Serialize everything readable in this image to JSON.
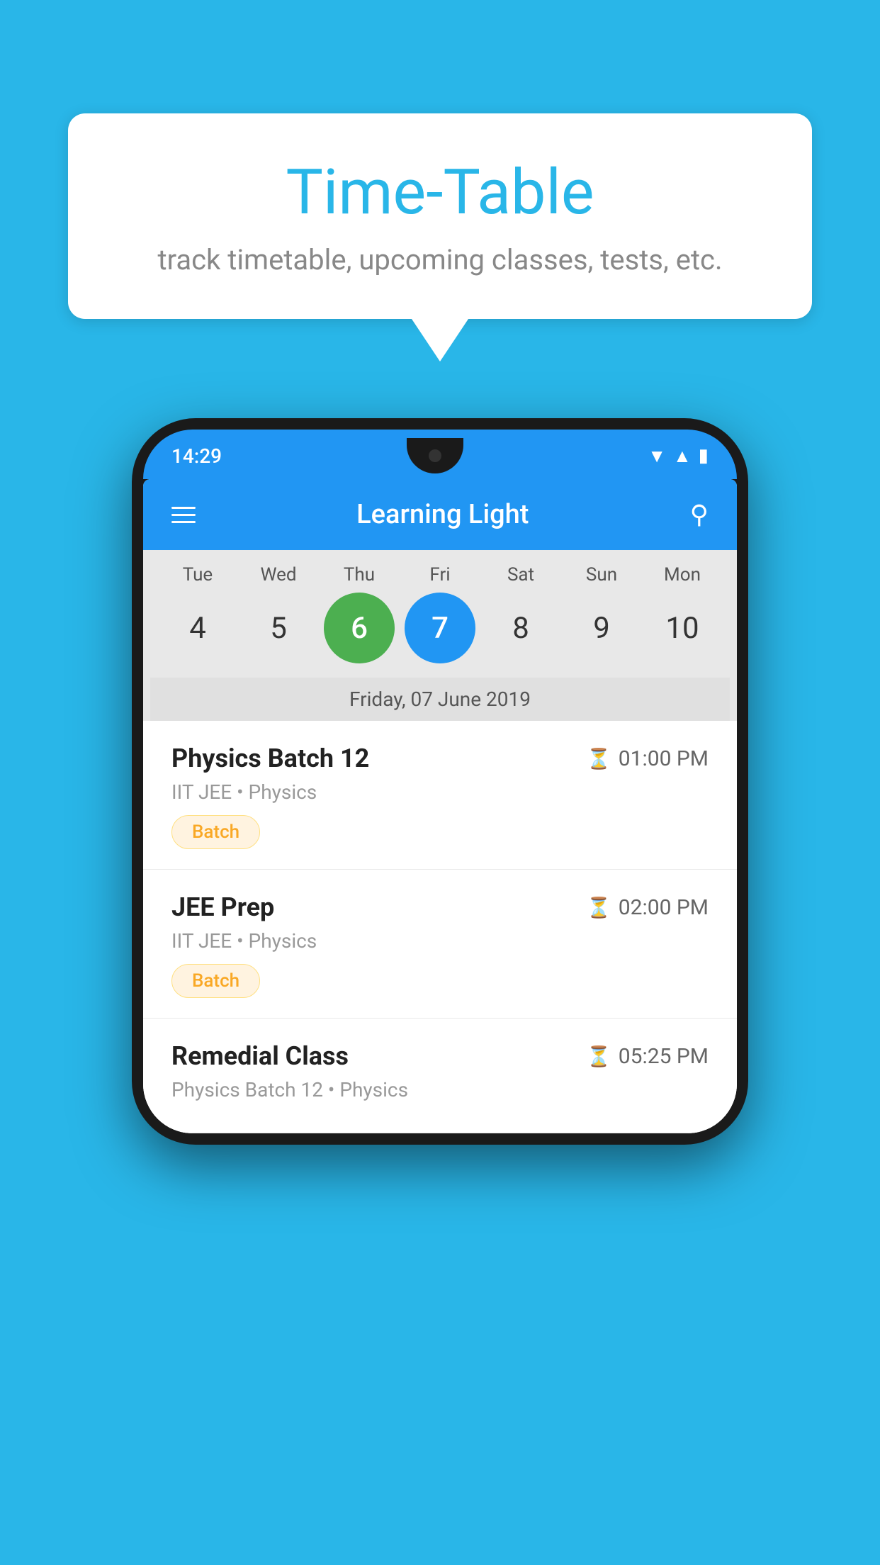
{
  "background_color": "#29b6e8",
  "speech_bubble": {
    "title": "Time-Table",
    "subtitle": "track timetable, upcoming classes, tests, etc."
  },
  "phone": {
    "status_bar": {
      "time": "14:29"
    },
    "app_header": {
      "title": "Learning Light",
      "menu_icon": "hamburger-icon",
      "search_icon": "search-icon"
    },
    "calendar": {
      "days": [
        "Tue",
        "Wed",
        "Thu",
        "Fri",
        "Sat",
        "Sun",
        "Mon"
      ],
      "dates": [
        "4",
        "5",
        "6",
        "7",
        "8",
        "9",
        "10"
      ],
      "today_index": 2,
      "selected_index": 3,
      "selected_date_label": "Friday, 07 June 2019"
    },
    "schedule_items": [
      {
        "title": "Physics Batch 12",
        "time": "01:00 PM",
        "subtitle": "IIT JEE • Physics",
        "badge": "Batch"
      },
      {
        "title": "JEE Prep",
        "time": "02:00 PM",
        "subtitle": "IIT JEE • Physics",
        "badge": "Batch"
      },
      {
        "title": "Remedial Class",
        "time": "05:25 PM",
        "subtitle": "Physics Batch 12 • Physics",
        "badge": ""
      }
    ]
  }
}
